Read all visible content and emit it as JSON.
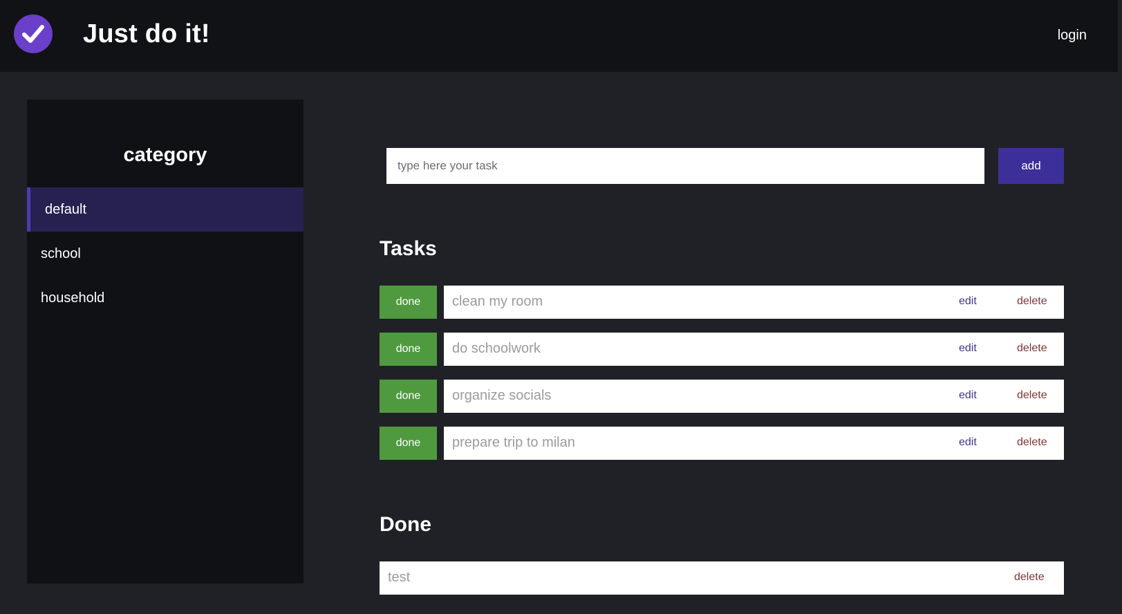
{
  "header": {
    "logo_icon": "check-circle-icon",
    "title": "Just do it!",
    "login_label": "login",
    "logo_color": "#6a3fc9"
  },
  "sidebar": {
    "title": "category",
    "items": [
      {
        "label": "default",
        "active": true
      },
      {
        "label": "school",
        "active": false
      },
      {
        "label": "household",
        "active": false
      }
    ]
  },
  "new_task": {
    "placeholder": "type here your task",
    "add_label": "add"
  },
  "tasks": {
    "title": "Tasks",
    "items": [
      {
        "done_label": "done",
        "text": "clean my room",
        "edit_label": "edit",
        "delete_label": "delete"
      },
      {
        "done_label": "done",
        "text": "do schoolwork",
        "edit_label": "edit",
        "delete_label": "delete"
      },
      {
        "done_label": "done",
        "text": "organize socials",
        "edit_label": "edit",
        "delete_label": "delete"
      },
      {
        "done_label": "done",
        "text": "prepare trip to milan",
        "edit_label": "edit",
        "delete_label": "delete"
      }
    ]
  },
  "done": {
    "title": "Done",
    "items": [
      {
        "text": "test",
        "delete_label": "delete"
      }
    ]
  },
  "colors": {
    "background": "#202126",
    "topbar": "#111215",
    "sidebar": "#101114",
    "active_category": "#272152",
    "accent": "#3d2f9a",
    "done_button": "#4f9a3f",
    "edit_link": "#3d3590",
    "delete_link": "#7d3535"
  }
}
